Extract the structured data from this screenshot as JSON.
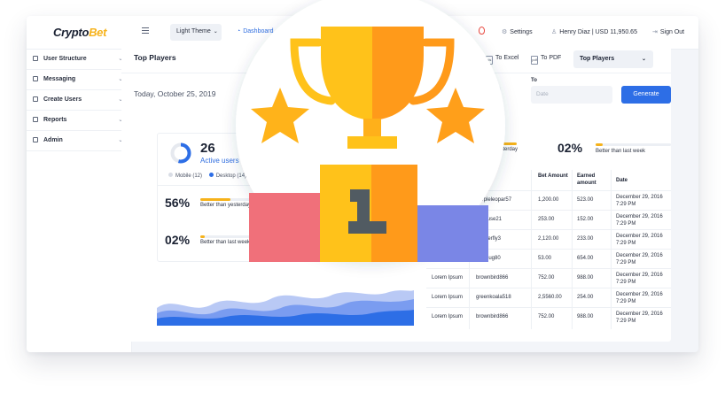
{
  "app": {
    "logo_part1": "Crypto",
    "logo_part2": "Bet",
    "theme_label": "Light Theme",
    "dashboard_label": "Dashboard",
    "settings_label": "Settings",
    "user_label": "Henry Diaz  |  USD 11,950.65",
    "signout_label": "Sign Out"
  },
  "sidebar": {
    "items": [
      {
        "label": "User Structure"
      },
      {
        "label": "Messaging"
      },
      {
        "label": "Create Users"
      },
      {
        "label": "Reports"
      },
      {
        "label": "Admin"
      }
    ]
  },
  "panel": {
    "title": "Top Players",
    "date": "Today, October 25, 2019",
    "export_excel": "To Excel",
    "export_pdf": "To PDF",
    "select_value": "Top Players",
    "to_label": "To",
    "date_placeholder": "Date",
    "generate_label": "Generate"
  },
  "stats": {
    "active_count": "26",
    "active_label": "Active users or",
    "legend_mobile": "Mobile (12)",
    "legend_desktop": "Desktop (14)",
    "today_pct": "56%",
    "today_label": "Better than yesterday",
    "today_fill": 0.56,
    "week_pct": "02%",
    "week_label": "Better than last week",
    "week_fill": 0.02,
    "right_today_label": "esterday",
    "right_week_pct": "02%",
    "right_week_label": "Better than last week",
    "donut_mobile_fraction": 0.46
  },
  "table": {
    "headers": {
      "bet": "Bet Amount",
      "earned": "Earned amount",
      "date": "Date"
    },
    "rows": [
      {
        "name": "",
        "user": "purpleleopar57",
        "bet": "1,200.00",
        "earned": "523.00",
        "date": "December 29, 2016 7:29 PM"
      },
      {
        "name": "",
        "user": "wmouse21",
        "bet": "253.00",
        "earned": "152.00",
        "date": "December 29, 2016 7:29 PM"
      },
      {
        "name": "",
        "user": "ebutterfly3",
        "bet": "2,120.00",
        "earned": "233.00",
        "date": "December 29, 2016 7:29 PM"
      },
      {
        "name": "",
        "user": "ladybug80",
        "bet": "53.00",
        "earned": "654.00",
        "date": "December 29, 2016 7:29 PM"
      },
      {
        "name": "Lorem Ipsum",
        "user": "brownbird866",
        "bet": "752.00",
        "earned": "988.00",
        "date": "December 29, 2016 7:29 PM"
      },
      {
        "name": "Lorem Ipsum",
        "user": "greenkoala518",
        "bet": "2,5560.00",
        "earned": "254.00",
        "date": "December 29, 2016 7:29 PM"
      },
      {
        "name": "Lorem Ipsum",
        "user": "brownbird866",
        "bet": "752.00",
        "earned": "988.00",
        "date": "December 29, 2016 7:29 PM"
      }
    ]
  },
  "colors": {
    "accent_blue": "#2d6ee6",
    "accent_yellow": "#f6b21a",
    "trophy_gold": "#ffc21a",
    "trophy_orange": "#ff9a1a",
    "podium_red": "#f0707a",
    "podium_purple": "#7a86e6",
    "rank_dark": "#515b62"
  },
  "overlay": {
    "icon": "trophy-podium-icon",
    "rank": "1"
  }
}
